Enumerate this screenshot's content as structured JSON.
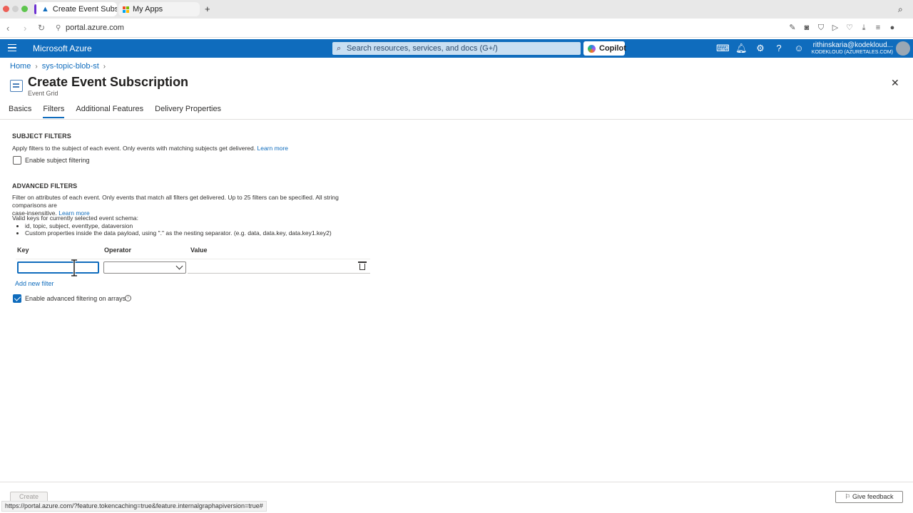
{
  "browser": {
    "tabs": [
      {
        "label": "Create Event Subscriptio",
        "active": true
      },
      {
        "label": "My Apps",
        "active": false
      }
    ],
    "url": "portal.azure.com",
    "status_url": "https://portal.azure.com/?feature.tokencaching=true&feature.internalgraphapiversion=true#"
  },
  "azure": {
    "brand": "Microsoft Azure",
    "search_placeholder": "Search resources, services, and docs (G+/)",
    "copilot_label": "Copilot",
    "account_name": "rithinskaria@kodekloud...",
    "account_org": "KODEKLOUD (AZURETALES.COM)"
  },
  "breadcrumb": [
    "Home",
    "sys-topic-blob-st"
  ],
  "page": {
    "title": "Create Event Subscription",
    "subtitle": "Event Grid",
    "ellipsis": "···",
    "tabs": [
      "Basics",
      "Filters",
      "Additional Features",
      "Delivery Properties"
    ],
    "selected_tab": "Filters"
  },
  "subject_filters": {
    "heading": "SUBJECT FILTERS",
    "description": "Apply filters to the subject of each event. Only events with matching subjects get delivered.",
    "learn_more": "Learn more",
    "checkbox_label": "Enable subject filtering",
    "checked": false
  },
  "advanced_filters": {
    "heading": "ADVANCED FILTERS",
    "description_line1": "Filter on attributes of each event. Only events that match all filters get delivered. Up to 25 filters can be specified. All string comparisons are",
    "description_line2": "case-insensitive.",
    "learn_more": "Learn more",
    "valid_keys_intro": "Valid keys for currently selected event schema:",
    "valid_keys": [
      "id, topic, subject, eventtype, dataversion",
      "Custom properties inside the data payload, using \".\" as the nesting separator. (e.g. data, data.key, data.key1.key2)"
    ],
    "columns": [
      "Key",
      "Operator",
      "Value"
    ],
    "row": {
      "key": "",
      "operator": "",
      "value": ""
    },
    "add_filter": "Add new filter",
    "arrays_label": "Enable advanced filtering on arrays",
    "arrays_checked": true
  },
  "footer": {
    "create": "Create",
    "feedback": "Give feedback"
  },
  "colors": {
    "azure_blue": "#0f6cbd",
    "accent_purple": "#6b2fd1"
  }
}
